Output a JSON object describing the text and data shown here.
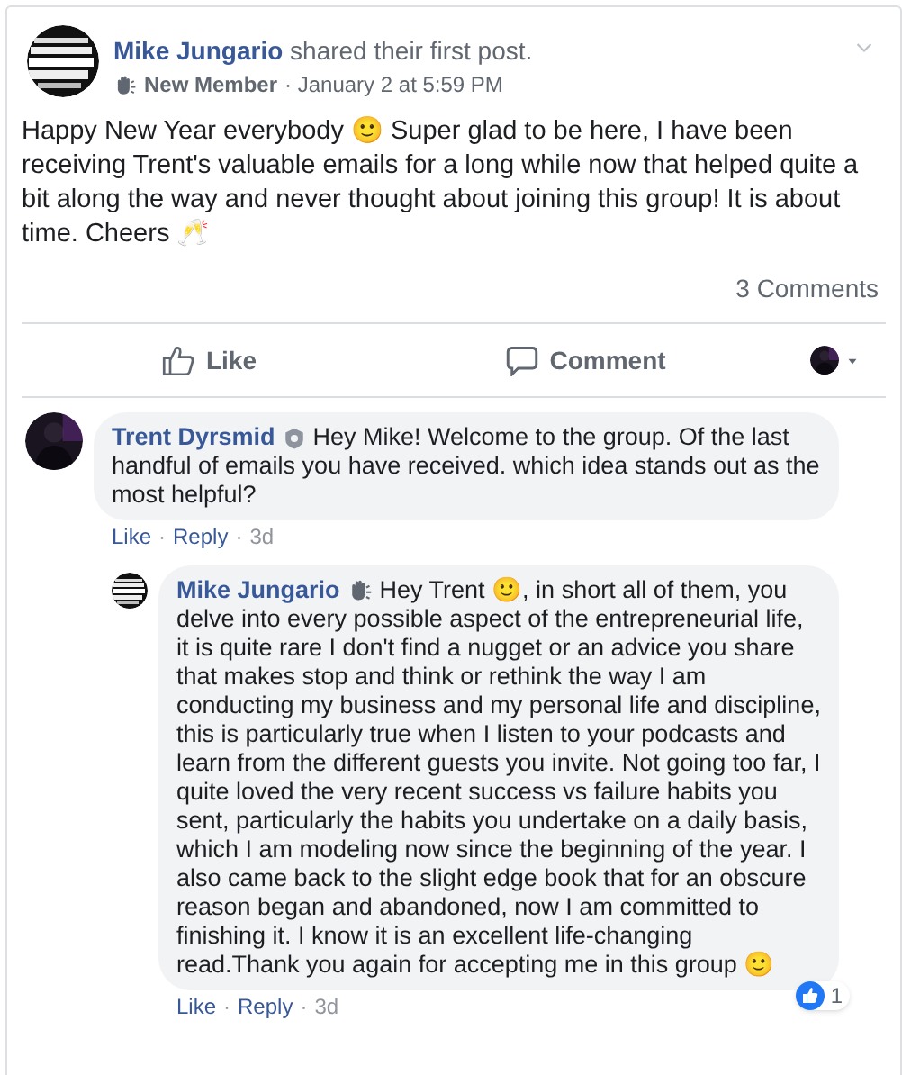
{
  "post": {
    "author": "Mike Jungario",
    "action": "shared their first post.",
    "badge": "New Member",
    "time": "· January 2 at 5:59 PM",
    "body": "Happy New Year everybody 🙂 Super glad to be here, I have been receiving Trent's valuable emails for a long while now that helped quite a bit along the way and never thought about joining this group! It is about time. Cheers 🥂",
    "comment_count": "3 Comments"
  },
  "actions": [
    {
      "kind": "like",
      "label": "Like"
    },
    {
      "kind": "comment",
      "label": "Comment"
    }
  ],
  "comments": [
    {
      "author": "Trent Dyrsmid",
      "kind": "admin",
      "body": "Hey Mike! Welcome to the group. Of the last handful of emails you have received. which idea stands out as the most helpful?",
      "footer": [
        {
          "kind": "link",
          "text": "Like"
        },
        {
          "kind": "sep",
          "text": "·"
        },
        {
          "kind": "link",
          "text": "Reply"
        },
        {
          "kind": "sep",
          "text": "·"
        },
        {
          "kind": "age",
          "text": "3d"
        }
      ],
      "replies": [
        {
          "author": "Mike Jungario",
          "kind": "member",
          "body": "Hey Trent 🙂, in short all of them, you delve into every possible aspect of the entrepreneurial life, it is quite rare I don't find a nugget or an advice you share that makes stop and think or rethink the way I am conducting my business and my personal life and discipline, this is particularly true when I listen to your podcasts and learn from the different guests you invite. Not going too far, I quite loved the very recent success vs failure habits you sent, particularly the habits you undertake on a daily basis, which I am modeling now since the beginning of the year. I also came back to the slight edge book that for an obscure reason began and abandoned, now I am committed to finishing it. I know it is an excellent life-changing read.Thank you again for accepting me in this group 🙂",
          "footer": [
            {
              "kind": "link",
              "text": "Like"
            },
            {
              "kind": "sep",
              "text": "·"
            },
            {
              "kind": "link",
              "text": "Reply"
            },
            {
              "kind": "sep",
              "text": "·"
            },
            {
              "kind": "age",
              "text": "3d"
            }
          ],
          "reactions": "1"
        }
      ]
    }
  ]
}
